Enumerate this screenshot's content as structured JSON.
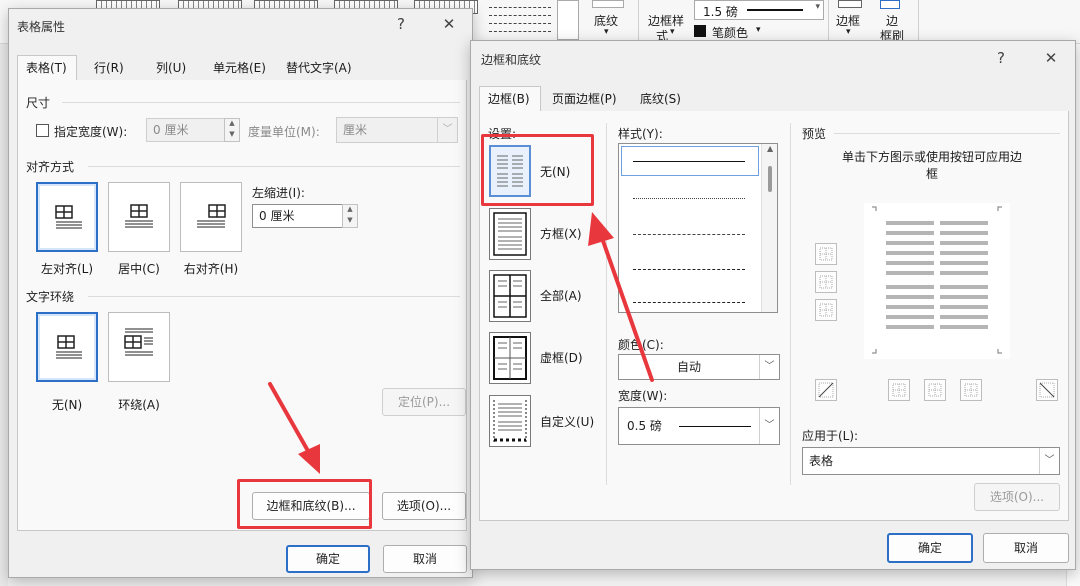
{
  "ribbon": {
    "weight_value": "1.5 磅",
    "shading_label": "底纹",
    "border_style_label_1": "边框样",
    "border_style_label_2": "式",
    "pen_color_label": "笔颜色",
    "borders_label": "边框",
    "painter_label_1": "边",
    "painter_label_2": "框刷"
  },
  "table_props": {
    "title": "表格属性",
    "help_icon": "?",
    "close_icon": "✕",
    "tabs": [
      "表格(T)",
      "行(R)",
      "列(U)",
      "单元格(E)",
      "替代文字(A)"
    ],
    "size": {
      "group": "尺寸",
      "preferred_width_label": "指定宽度(W):",
      "width_value": "0 厘米",
      "unit_label": "度量单位(M):",
      "unit_value": "厘米"
    },
    "alignment": {
      "group": "对齐方式",
      "options": [
        "左对齐(L)",
        "居中(C)",
        "右对齐(H)"
      ],
      "indent_label": "左缩进(I):",
      "indent_value": "0 厘米"
    },
    "wrapping": {
      "group": "文字环绕",
      "options": [
        "无(N)",
        "环绕(A)"
      ],
      "position_button": "定位(P)..."
    },
    "borders_button": "边框和底纹(B)...",
    "options_button": "选项(O)...",
    "ok": "确定",
    "cancel": "取消"
  },
  "borders_dialog": {
    "title": "边框和底纹",
    "help_icon": "?",
    "close_icon": "✕",
    "tabs": [
      "边框(B)",
      "页面边框(P)",
      "底纹(S)"
    ],
    "setting_label": "设置:",
    "settings": [
      "无(N)",
      "方框(X)",
      "全部(A)",
      "虚框(D)",
      "自定义(U)"
    ],
    "style_label": "样式(Y):",
    "color_label": "颜色(C):",
    "color_value": "自动",
    "width_label": "宽度(W):",
    "width_value": "0.5 磅",
    "preview_label": "预览",
    "preview_hint": "单击下方图示或使用按钮可应用边框",
    "apply_to_label": "应用于(L):",
    "apply_to_value": "表格",
    "options_button": "选项(O)...",
    "ok": "确定",
    "cancel": "取消"
  },
  "colors": {
    "highlight": "#e8383d",
    "accent": "#2b6fc7"
  }
}
